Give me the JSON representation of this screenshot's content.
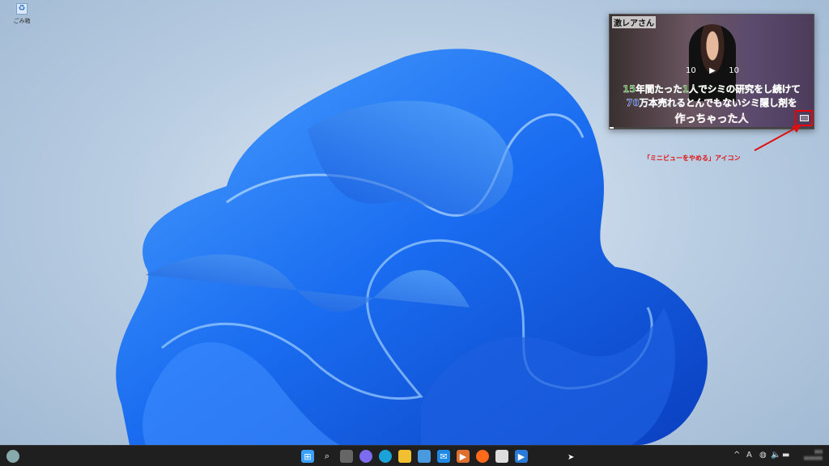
{
  "desktop": {
    "icons": [
      {
        "label": "ごみ箱",
        "icon": "recycle-bin-icon"
      }
    ]
  },
  "mini_player": {
    "show_logo": "激レアさん",
    "controls": {
      "rewind": "10",
      "play": "▶",
      "forward": "10"
    },
    "caption_line1": "15年間たった1人でシミの研究をし続けて",
    "caption_line2a": "70万本売れる",
    "caption_line2b": "とんでもないシミ隠し剤を",
    "caption_line3": "作っちゃった人",
    "progress": 0.02
  },
  "annotation": {
    "text": "「ミニビューをやめる」アイコン",
    "color": "#e01010"
  },
  "taskbar": {
    "apps": [
      {
        "name": "start",
        "icon": "windows-icon"
      },
      {
        "name": "search",
        "icon": "search-icon"
      },
      {
        "name": "task-view",
        "icon": "task-view-icon"
      },
      {
        "name": "chat",
        "icon": "chat-icon"
      },
      {
        "name": "edge",
        "icon": "edge-icon"
      },
      {
        "name": "file-explorer",
        "icon": "folder-icon"
      },
      {
        "name": "store",
        "icon": "store-icon"
      },
      {
        "name": "mail",
        "icon": "mail-icon"
      },
      {
        "name": "media-player",
        "icon": "media-player-icon"
      },
      {
        "name": "firefox",
        "icon": "firefox-icon"
      },
      {
        "name": "notepad",
        "icon": "notepad-icon"
      },
      {
        "name": "movies-tv",
        "icon": "movies-icon"
      }
    ],
    "tray": {
      "chevron": "^",
      "ime": "A"
    }
  }
}
